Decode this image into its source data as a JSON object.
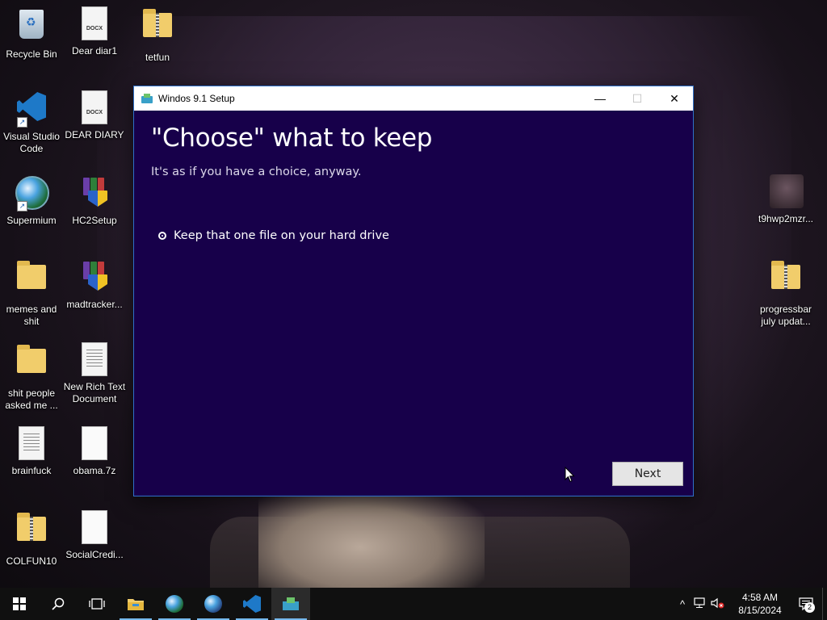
{
  "desktop": {
    "icons": [
      {
        "label": "Recycle Bin",
        "icon": "recycle-bin-icon"
      },
      {
        "label": "Dear diar1",
        "icon": "docx-icon",
        "tag": "DOCX"
      },
      {
        "label": "tetfun",
        "icon": "zip-folder-icon"
      },
      {
        "label": "Visual Studio Code",
        "icon": "vscode-icon"
      },
      {
        "label": "DEAR DIARY",
        "icon": "docx-icon",
        "tag": "DOCX"
      },
      {
        "label": "Supermium",
        "icon": "browser-icon"
      },
      {
        "label": "HC2Setup",
        "icon": "winrar-icon"
      },
      {
        "label": "memes and shit",
        "icon": "folder-icon"
      },
      {
        "label": "madtracker...",
        "icon": "winrar-icon"
      },
      {
        "label": "shit people asked me ...",
        "icon": "folder-icon"
      },
      {
        "label": "New Rich Text Document",
        "icon": "rtf-icon"
      },
      {
        "label": "brainfuck",
        "icon": "text-file-icon"
      },
      {
        "label": "obama.7z",
        "icon": "file-icon"
      },
      {
        "label": "COLFUN10",
        "icon": "zip-folder-icon"
      },
      {
        "label": "SocialCredi...",
        "icon": "file-icon"
      },
      {
        "label": "t9hwp2mzr...",
        "icon": "image-icon"
      },
      {
        "label": "progressbar july updat...",
        "icon": "zip-folder-icon"
      }
    ]
  },
  "window": {
    "title": "Windos 9.1 Setup",
    "controls": {
      "minimize": "—",
      "maximize": "☐",
      "close": "✕"
    },
    "heading": "\"Choose\" what to keep",
    "subtitle": "It's as if you have a choice, anyway.",
    "options": [
      {
        "label": "Keep that one file on your hard drive",
        "selected": true
      }
    ],
    "next_label": "Next"
  },
  "taskbar": {
    "pinned": [
      "start-icon",
      "search-icon",
      "task-view-icon",
      "file-explorer-icon",
      "browser-icon",
      "browser-icon",
      "vscode-icon",
      "setup-icon"
    ],
    "clock": {
      "time": "4:58 AM",
      "date": "8/15/2024"
    },
    "notifications_count": "2",
    "tray_icons": [
      "chevron-up-icon",
      "network-icon",
      "volume-muted-icon"
    ]
  },
  "colors": {
    "window_bg": "#17004a",
    "window_border": "#2f70c8",
    "taskbar_bg": "#101010",
    "accent": "#76b9ed"
  }
}
